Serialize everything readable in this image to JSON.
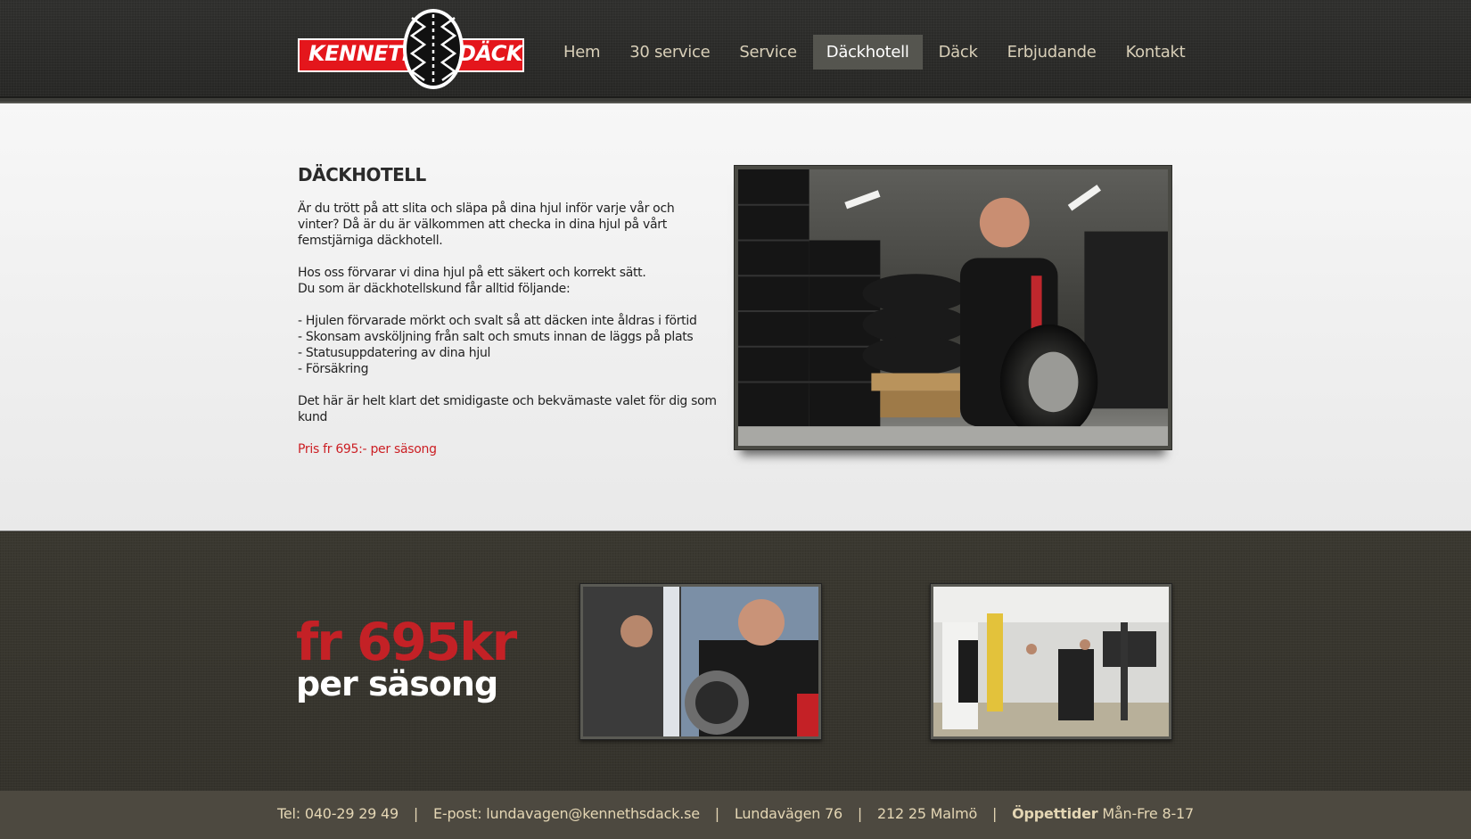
{
  "brand": {
    "name_left": "KENNETH'S",
    "name_right": "DÄCK",
    "logo_red": "#e4161c"
  },
  "nav": {
    "items": [
      {
        "label": "Hem",
        "active": false
      },
      {
        "label": "30 service",
        "active": false
      },
      {
        "label": "Service",
        "active": false
      },
      {
        "label": "Däckhotell",
        "active": true
      },
      {
        "label": "Däck",
        "active": false
      },
      {
        "label": "Erbjudande",
        "active": false
      },
      {
        "label": "Kontakt",
        "active": false
      }
    ]
  },
  "content": {
    "title": "DÄCKHOTELL",
    "intro": "Är du trött på att slita och släpa på dina hjul inför varje vår och vinter? Då är du är välkommen att checka in dina hjul på vårt femstjärniga däckhotell.",
    "storage_line1": "Hos oss förvarar vi dina hjul på ett säkert och korrekt sätt.",
    "storage_line2": "Du som är däckhotellskund får alltid följande:",
    "benefits": [
      "- Hjulen förvarade mörkt och svalt så att däcken inte åldras i förtid",
      "- Skonsam avsköljning från salt och smuts innan de läggs på plats",
      "- Statusuppdatering av dina hjul",
      "- Försäkring"
    ],
    "closing": " Det här är helt klart det smidigaste och bekvämaste valet för dig som kund",
    "price": "Pris fr 695:- per säsong",
    "price_color": "#cc1f24"
  },
  "promo": {
    "price": "fr 695kr",
    "season": "per säsong",
    "price_color": "#c42126"
  },
  "footer": {
    "tel": "Tel: 040-29 29 49",
    "email": "E-post: lundavagen@kennethsdack.se",
    "address": "Lundavägen 76",
    "city": "212 25 Malmö",
    "hours_label": "Öppettider",
    "hours": "Mån-Fre 8-17",
    "separator": "|"
  }
}
